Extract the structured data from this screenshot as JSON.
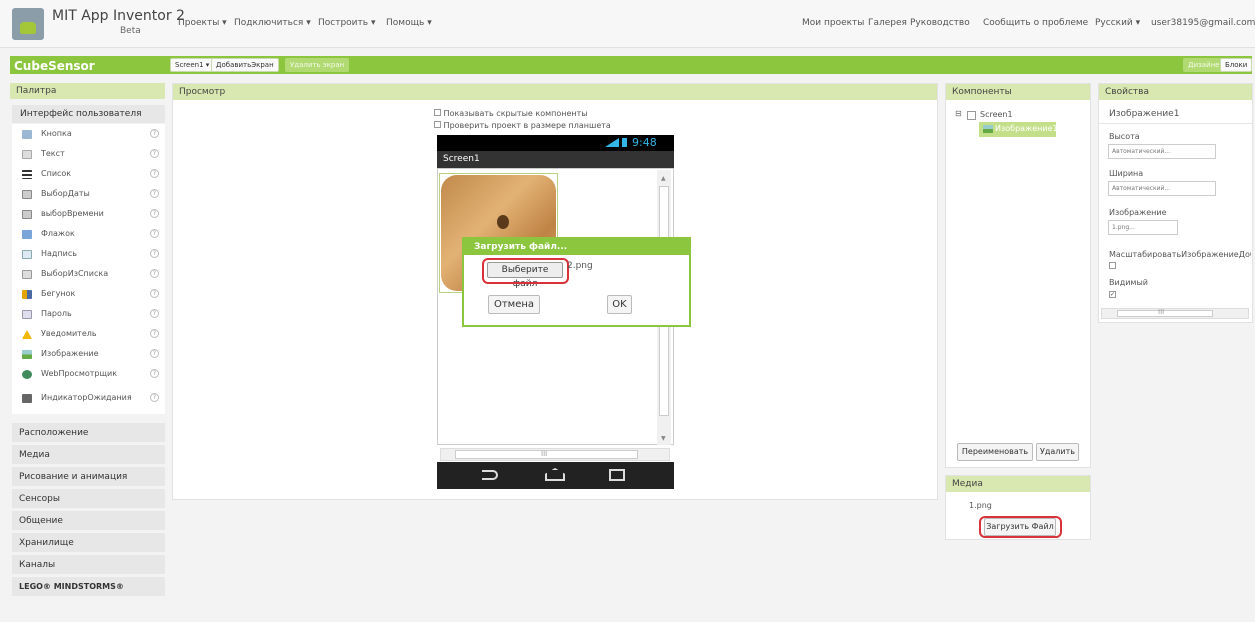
{
  "app": {
    "title": "MIT App Inventor 2",
    "beta": "Beta"
  },
  "menu": {
    "projects": "Проекты ▾",
    "connect": "Подключиться ▾",
    "build": "Построить ▾",
    "help": "Помощь ▾"
  },
  "top_right": {
    "my_projects": "Мои проекты",
    "gallery": "Галерея",
    "guide": "Руководство",
    "report": "Сообщить о проблеме",
    "language": "Русский ▾",
    "user": "user38195@gmail.com ▾"
  },
  "project": {
    "name": "CubeSensor",
    "screen_select": "Screen1 ▾",
    "add_screen": "ДобавитьЭкран",
    "remove_screen": "Удалить экран",
    "designer": "Дизайнер",
    "blocks": "Блоки"
  },
  "palette": {
    "title": "Палитра",
    "ui_category": "Интерфейс пользователя",
    "items": [
      {
        "label": "Кнопка"
      },
      {
        "label": "Текст"
      },
      {
        "label": "Список"
      },
      {
        "label": "ВыборДаты"
      },
      {
        "label": "выборВремени"
      },
      {
        "label": "Флажок"
      },
      {
        "label": "Надпись"
      },
      {
        "label": "ВыборИзСписка"
      },
      {
        "label": "Бегунок"
      },
      {
        "label": "Пароль"
      },
      {
        "label": "Уведомитель"
      },
      {
        "label": "Изображение"
      },
      {
        "label": "WebПросмотрщик"
      },
      {
        "label": "ИндикаторОжидания"
      }
    ],
    "help": "?",
    "categories": [
      {
        "label": "Расположение"
      },
      {
        "label": "Медиа"
      },
      {
        "label": "Рисование и анимация"
      },
      {
        "label": "Сенсоры"
      },
      {
        "label": "Общение"
      },
      {
        "label": "Хранилище"
      },
      {
        "label": "Каналы"
      },
      {
        "label": "LEGO® MINDSTORMS®"
      }
    ]
  },
  "viewer": {
    "title": "Просмотр",
    "show_hidden": "Показывать скрытые компоненты",
    "tablet_check": "Проверить проект в размере планшета",
    "status_time": "9:48",
    "screen_title": "Screen1",
    "hscroll_grip": "III"
  },
  "dialog": {
    "title": "Загрузить файл...",
    "choose_file": "Выберите файл",
    "file_name": "2.png",
    "cancel": "Отмена",
    "ok": "OK"
  },
  "components": {
    "title": "Компоненты",
    "tree": {
      "collapse": "⊟",
      "screen": "Screen1",
      "child": "Изображение1"
    },
    "rename": "Переименовать",
    "delete": "Удалить"
  },
  "media": {
    "title": "Медиа",
    "file": "1.png",
    "upload": "Загрузить Файл"
  },
  "properties": {
    "title": "Свойства",
    "component": "Изображение1",
    "height_label": "Высота",
    "height_value": "Автоматический...",
    "width_label": "Ширина",
    "width_value": "Автоматический...",
    "image_label": "Изображение",
    "image_value": "1.png...",
    "scale_label": "МасштабироватьИзображениеДоС",
    "visible_label": "Видимый",
    "visible_check": "✓",
    "scroll_grip": "III"
  },
  "colors": {
    "accent_green": "#8cc63f",
    "highlight_red": "#d9323a",
    "panel_header": "#d8e8b0"
  }
}
